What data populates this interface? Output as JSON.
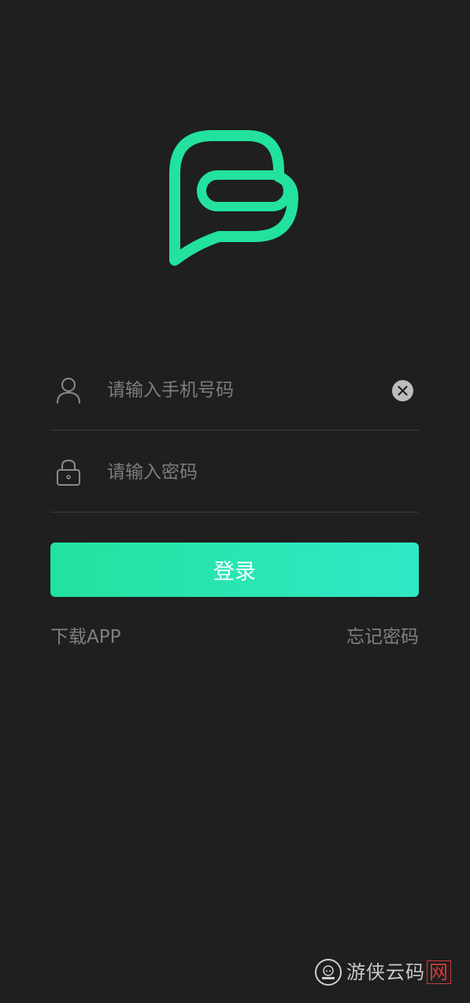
{
  "brand": {
    "logo_icon": "speech-bubble-logo-icon",
    "accent_color": "#22e29e",
    "accent_color_end": "#2fe9c6"
  },
  "form": {
    "phone": {
      "icon": "user-icon",
      "placeholder": "请输入手机号码",
      "value": "",
      "clear_icon": "clear-icon"
    },
    "password": {
      "icon": "lock-icon",
      "placeholder": "请输入密码",
      "value": ""
    },
    "login_label": "登录"
  },
  "links": {
    "download": "下载APP",
    "forgot_password": "忘记密码"
  },
  "watermark": {
    "text": "游侠云码",
    "suffix": "网"
  }
}
